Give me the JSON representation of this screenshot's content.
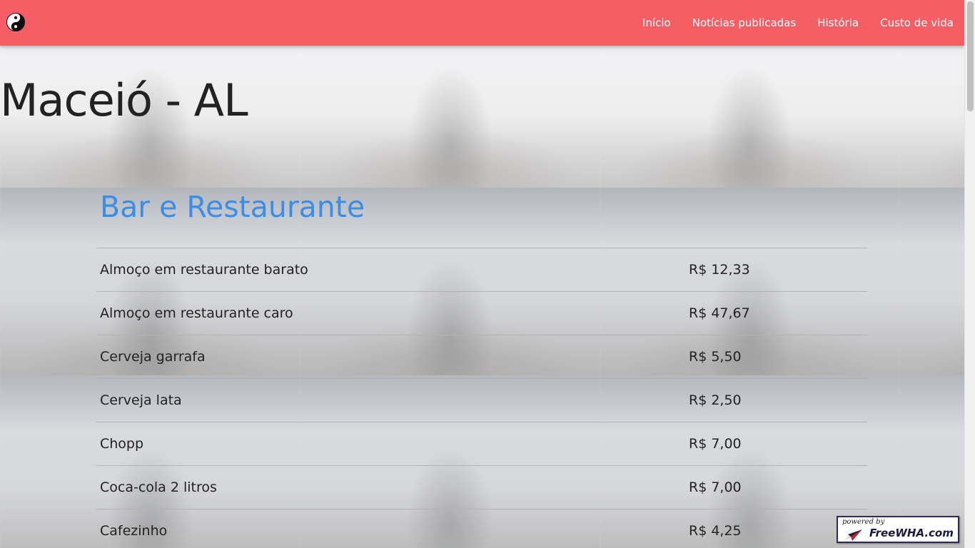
{
  "navbar": {
    "logo_icon": "yin-yang-icon",
    "background_color": "#f65e66",
    "links": [
      {
        "label": "Início"
      },
      {
        "label": "Notícias publicadas"
      },
      {
        "label": "História"
      },
      {
        "label": "Custo de vida"
      }
    ]
  },
  "page": {
    "city_title": "Maceió - AL",
    "section_title": "Bar e Restaurante",
    "section_title_color": "#3a8ee6"
  },
  "prices": [
    {
      "item": "Almoço em restaurante barato",
      "price": "R$ 12,33"
    },
    {
      "item": "Almoço em restaurante caro",
      "price": "R$ 47,67"
    },
    {
      "item": "Cerveja garrafa",
      "price": "R$ 5,50"
    },
    {
      "item": "Cerveja lata",
      "price": "R$ 2,50"
    },
    {
      "item": "Chopp",
      "price": "R$ 7,00"
    },
    {
      "item": "Coca-cola 2 litros",
      "price": "R$ 7,00"
    },
    {
      "item": "Cafezinho",
      "price": "R$ 4,25"
    }
  ],
  "badge": {
    "small_text": "powered by",
    "main_text": "FreeWHA.com"
  }
}
